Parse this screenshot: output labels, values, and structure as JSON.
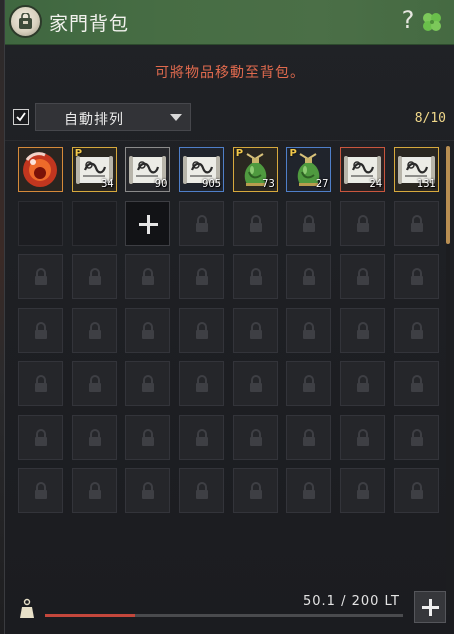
{
  "window": {
    "title": "家門背包",
    "help_label": "?",
    "emblem_icon": "bag-emblem-icon",
    "clover_icon": "clover-icon"
  },
  "notice": "可將物品移動至背包。",
  "toolbar": {
    "auto_sort_checked": true,
    "sort_label": "自動排列",
    "slot_count": "8/10"
  },
  "items": [
    {
      "name": "red-orb-item",
      "quantity": "",
      "border": "orange",
      "premium": false
    },
    {
      "name": "scroll-item",
      "quantity": "34",
      "border": "gold",
      "premium": true
    },
    {
      "name": "scroll-item",
      "quantity": "90",
      "border": "gray",
      "premium": false
    },
    {
      "name": "scroll-item",
      "quantity": "905",
      "border": "blue",
      "premium": false
    },
    {
      "name": "green-elixir-item",
      "quantity": "73",
      "border": "gold",
      "premium": true
    },
    {
      "name": "green-elixir-item",
      "quantity": "27",
      "border": "blue",
      "premium": true
    },
    {
      "name": "scroll-item",
      "quantity": "24",
      "border": "red",
      "premium": false
    },
    {
      "name": "scroll-item",
      "quantity": "131",
      "border": "gold",
      "premium": false
    }
  ],
  "grid": {
    "columns": 8,
    "rows": 7,
    "open_empty_slots": 2,
    "add_slot_icon": "plus-icon",
    "locked_icon": "lock-icon"
  },
  "footer": {
    "weight_text": "50.1 / 200 LT",
    "weight_current": 50.1,
    "weight_max": 200,
    "expand_icon": "plus-icon"
  },
  "colors": {
    "header_green": "#476d44",
    "notice_red": "#e06a4e",
    "count_gold": "#f0d88a",
    "weight_bar": "#c4473c"
  }
}
